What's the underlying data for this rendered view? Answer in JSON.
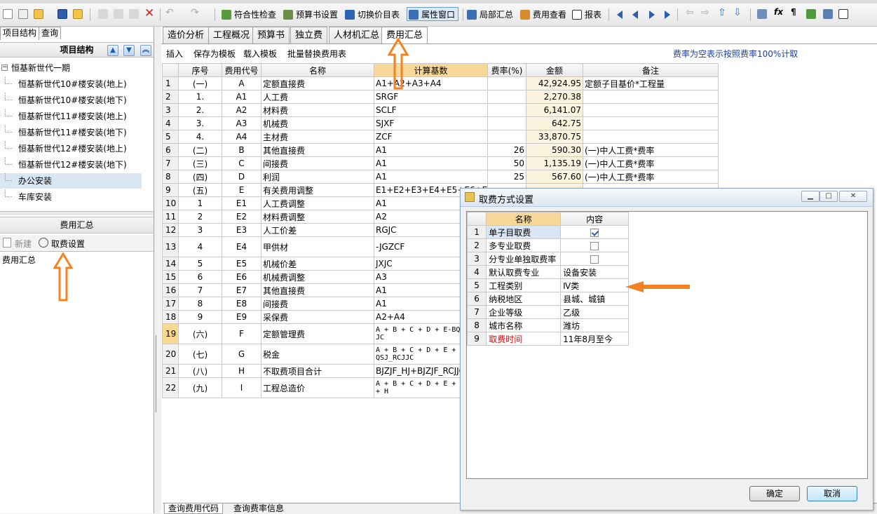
{
  "toolbar": {
    "check": "符合性检查",
    "budget": "预算书设置",
    "switch_price": "切换价目表",
    "prop_window": "属性窗口",
    "local_summary": "局部汇总",
    "fee_view": "费用查看",
    "report": "报表"
  },
  "left": {
    "tabs": [
      "项目结构",
      "查询"
    ],
    "tree_header": "项目结构",
    "tree": [
      {
        "label": "恒基新世代一期",
        "level": 0,
        "expander": "−"
      },
      {
        "label": "恒基新世代10#楼安装(地上)",
        "level": 1
      },
      {
        "label": "恒基新世代10#楼安装(地下)",
        "level": 1
      },
      {
        "label": "恒基新世代11#楼安装(地上)",
        "level": 1
      },
      {
        "label": "恒基新世代11#楼安装(地下)",
        "level": 1
      },
      {
        "label": "恒基新世代12#楼安装(地上)",
        "level": 1
      },
      {
        "label": "恒基新世代12#楼安装(地下)",
        "level": 1
      },
      {
        "label": "办公安装",
        "level": 1,
        "selected": true
      },
      {
        "label": "车库安装",
        "level": 1
      }
    ],
    "fee_header": "费用汇总",
    "fee_tools": {
      "new": "新建",
      "setting": "取费设置"
    },
    "fee_list": [
      "费用汇总"
    ]
  },
  "main": {
    "tabs": [
      "造价分析",
      "工程概况",
      "预算书",
      "独立费",
      "人材机汇总",
      "费用汇总"
    ],
    "subbar": {
      "insert": "插入",
      "save_template": "保存为模板",
      "load_template": "载入模板",
      "batch_replace": "批量替换费用表",
      "note": "费率为空表示按照费率100%计取"
    },
    "columns": [
      "",
      "序号",
      "费用代号",
      "名称",
      "计算基数",
      "费率(%)",
      "金额",
      "备注"
    ],
    "rows": [
      [
        "1",
        "(一)",
        "A",
        "定额直接费",
        "A1+A2+A3+A4",
        "",
        "42,924.95",
        "定额子目基价*工程量"
      ],
      [
        "2",
        "1.",
        "A1",
        "人工费",
        "SRGF",
        "",
        "2,270.38",
        ""
      ],
      [
        "3",
        "2.",
        "A2",
        "材料费",
        "SCLF",
        "",
        "6,141.07",
        ""
      ],
      [
        "4",
        "3.",
        "A3",
        "机械费",
        "SJXF",
        "",
        "642.75",
        ""
      ],
      [
        "5",
        "4.",
        "A4",
        "主材费",
        "ZCF",
        "",
        "33,870.75",
        ""
      ],
      [
        "6",
        "(二)",
        "B",
        "其他直接费",
        "A1",
        "26",
        "590.30",
        "(一)中人工费*费率"
      ],
      [
        "7",
        "(三)",
        "C",
        "间接费",
        "A1",
        "50",
        "1,135.19",
        "(一)中人工费*费率"
      ],
      [
        "8",
        "(四)",
        "D",
        "利润",
        "A1",
        "25",
        "567.60",
        "(一)中人工费*费率"
      ],
      [
        "9",
        "(五)",
        "E",
        "有关费用调整",
        "E1+E2+E3+E4+E5+E6+E7+E8+E9",
        "",
        "",
        ""
      ],
      [
        "10",
        "1",
        "E1",
        "人工费调整",
        "A1",
        "",
        "",
        ""
      ],
      [
        "11",
        "2",
        "E2",
        "材料费调整",
        "A2",
        "",
        "",
        ""
      ],
      [
        "12",
        "3",
        "E3",
        "人工价差",
        "RGJC",
        "",
        "",
        ""
      ],
      [
        "13",
        "4",
        "E4",
        "甲供材",
        "-JGZCF",
        "",
        "",
        ""
      ],
      [
        "14",
        "5",
        "E5",
        "机械价差",
        "JXJC",
        "",
        "",
        ""
      ],
      [
        "15",
        "6",
        "E6",
        "机械费调整",
        "A3",
        "",
        "",
        ""
      ],
      [
        "16",
        "7",
        "E7",
        "其他直接费",
        "A1",
        "",
        "",
        ""
      ],
      [
        "17",
        "8",
        "E8",
        "间接费",
        "A1",
        "",
        "",
        ""
      ],
      [
        "18",
        "9",
        "E9",
        "采保费",
        "A2+A4",
        "",
        "",
        ""
      ],
      [
        "19",
        "(六)",
        "F",
        "定额管理费",
        "A + B + C + D + E-BQGF_RCJJC",
        "",
        "",
        ""
      ],
      [
        "20",
        "(七)",
        "G",
        "税金",
        "A + B + C + D + E + F_HJ-BQSJ_RCJJC",
        "",
        "",
        ""
      ],
      [
        "21",
        "(八)",
        "H",
        "不取费项目合计",
        "BJZJF_HJ+BJZJF_RCJJC",
        "",
        "",
        ""
      ],
      [
        "22",
        "(九)",
        "I",
        "工程总造价",
        "A + B + C + D + E + F + G + H",
        "",
        "",
        ""
      ]
    ],
    "bottom_tabs": [
      "查询费用代码",
      "查询费率信息"
    ]
  },
  "dialog": {
    "title": "取费方式设置",
    "columns": [
      "",
      "名称",
      "内容"
    ],
    "rows": [
      {
        "n": "1",
        "name": "单子目取费",
        "type": "check",
        "checked": true
      },
      {
        "n": "2",
        "name": "多专业取费",
        "type": "check",
        "checked": false
      },
      {
        "n": "3",
        "name": "分专业单独取费率",
        "type": "check",
        "checked": false
      },
      {
        "n": "4",
        "name": "默认取费专业",
        "value": "设备安装"
      },
      {
        "n": "5",
        "name": "工程类别",
        "value": "Ⅳ类"
      },
      {
        "n": "6",
        "name": "纳税地区",
        "value": "县城、城镇"
      },
      {
        "n": "7",
        "name": "企业等级",
        "value": "乙级"
      },
      {
        "n": "8",
        "name": "城市名称",
        "value": "潍坊"
      },
      {
        "n": "9",
        "name": "取费时间",
        "value": "11年8月至今",
        "red": true
      }
    ],
    "ok": "确定",
    "cancel": "取消"
  },
  "colors": {
    "accent": "#f58220",
    "selected": "#dbe6f5",
    "header_highlight": "#f7d79a",
    "link_blue": "#1a3fa0"
  }
}
